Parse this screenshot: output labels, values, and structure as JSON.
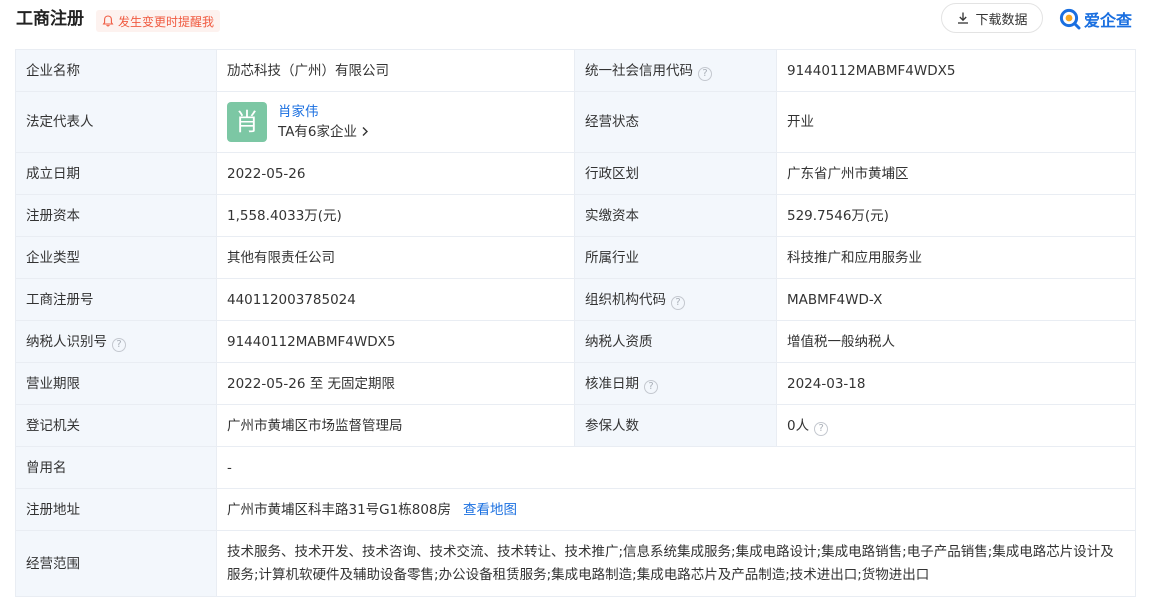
{
  "header": {
    "title": "工商注册",
    "notify_label": "发生变更时提醒我",
    "download_label": "下载数据",
    "brand_name": "爱企查"
  },
  "rows": [
    {
      "l1": "企业名称",
      "v1": "劢芯科技（广州）有限公司",
      "l2": "统一社会信用代码",
      "v2": "91440112MABMF4WDX5"
    },
    {
      "l1": "法定代表人",
      "rep_avatar": "肖",
      "rep_name": "肖家伟",
      "rep_more": "TA有6家企业",
      "l2": "经营状态",
      "v2": "开业"
    },
    {
      "l1": "成立日期",
      "v1": "2022-05-26",
      "l2": "行政区划",
      "v2": "广东省广州市黄埔区"
    },
    {
      "l1": "注册资本",
      "v1": "1,558.4033万(元)",
      "l2": "实缴资本",
      "v2": "529.7546万(元)"
    },
    {
      "l1": "企业类型",
      "v1": "其他有限责任公司",
      "l2": "所属行业",
      "v2": "科技推广和应用服务业"
    },
    {
      "l1": "工商注册号",
      "v1": "440112003785024",
      "l2": "组织机构代码",
      "v2": "MABMF4WD-X"
    },
    {
      "l1": "纳税人识别号",
      "v1": "91440112MABMF4WDX5",
      "l2": "纳税人资质",
      "v2": "增值税一般纳税人"
    },
    {
      "l1": "营业期限",
      "v1": "2022-05-26 至 无固定期限",
      "l2": "核准日期",
      "v2": "2024-03-18"
    },
    {
      "l1": "登记机关",
      "v1": "广州市黄埔区市场监督管理局",
      "l2": "参保人数",
      "v2": "0人"
    },
    {
      "l1": "曾用名",
      "v1": "-"
    },
    {
      "l1": "注册地址",
      "v1": "广州市黄埔区科丰路31号G1栋808房",
      "link": "查看地图"
    },
    {
      "l1": "经营范围",
      "v1": "技术服务、技术开发、技术咨询、技术交流、技术转让、技术推广;信息系统集成服务;集成电路设计;集成电路销售;电子产品销售;集成电路芯片设计及服务;计算机软硬件及辅助设备零售;办公设备租赁服务;集成电路制造;集成电路芯片及产品制造;技术进出口;货物进出口"
    }
  ],
  "help_glyph": "?",
  "colors": {
    "accent": "#1a6fe0",
    "label_bg": "#f3f7fc",
    "notify": "#f05b41",
    "avatar": "#7cc7a4"
  }
}
